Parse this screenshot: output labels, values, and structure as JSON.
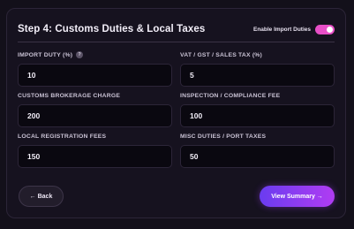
{
  "header": {
    "title": "Step 4: Customs Duties & Local Taxes",
    "toggle_label": "Enable Import Duties",
    "toggle_on": true
  },
  "fields": [
    {
      "label": "IMPORT DUTY (%)",
      "value": "10",
      "has_help": true,
      "help_glyph": "?"
    },
    {
      "label": "VAT / GST / SALES TAX (%)",
      "value": "5"
    },
    {
      "label": "CUSTOMS BROKERAGE CHARGE",
      "value": "200"
    },
    {
      "label": "INSPECTION / COMPLIANCE FEE",
      "value": "100"
    },
    {
      "label": "LOCAL REGISTRATION FEES",
      "value": "150"
    },
    {
      "label": "MISC DUTIES / PORT TAXES",
      "value": "50"
    }
  ],
  "buttons": {
    "back_label": "← Back",
    "next_label": "View Summary →"
  },
  "colors": {
    "accent_toggle": "#e84fc7",
    "gradient_start": "#6a3cf0",
    "gradient_end": "#b03cf2"
  }
}
